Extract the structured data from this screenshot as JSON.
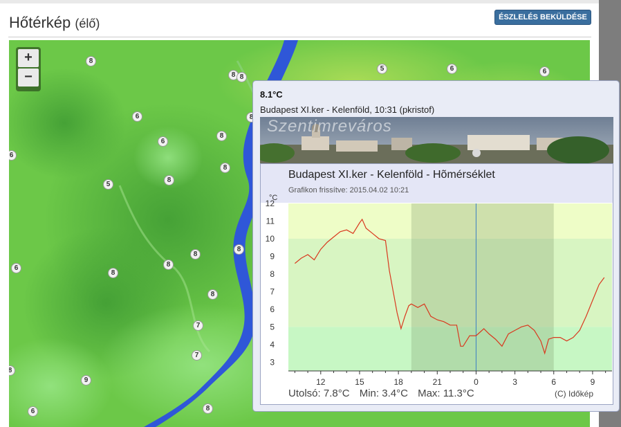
{
  "header": {
    "title": "Hőtérkép",
    "title_sub": "(élő)",
    "report_button": "ÉSZLELÉS BEKÜLDÉSE"
  },
  "map": {
    "zoom_in": "+",
    "zoom_out": "−",
    "markers": [
      "8",
      "8",
      "8",
      "5",
      "6",
      "6",
      "6",
      "6",
      "8",
      "6",
      "8",
      "5",
      "8",
      "8",
      "8",
      "8",
      "6",
      "8",
      "8",
      "8",
      "8",
      "7",
      "7",
      "9",
      "6",
      "8",
      "9"
    ]
  },
  "popup": {
    "temperature": "8.1°C",
    "location": "Budapest XI.ker - Kelenföld, 10:31 (pkristof)",
    "webcam_label": "Szentimreváros",
    "chart_title": "Budapest XI.ker - Kelenföld - Hõmérséklet",
    "chart_updated": "Grafikon frissítve: 2015.04.02 10:21",
    "stats_last": "Utolsó: 7.8°C",
    "stats_min": "Min: 3.4°C",
    "stats_max": "Max: 11.3°C",
    "copyright": "(C) Időkép"
  },
  "chart_data": {
    "type": "line",
    "ylabel": "°C",
    "ylim": [
      2.5,
      12
    ],
    "yticks": [
      3,
      4,
      5,
      6,
      7,
      8,
      9,
      10,
      11,
      12
    ],
    "xticks": [
      "12",
      "15",
      "18",
      "21",
      "0",
      "3",
      "6",
      "9"
    ],
    "series": [
      {
        "values_x_hours": [
          10,
          10.5,
          11,
          11.5,
          12,
          12.5,
          13,
          13.5,
          14,
          14.5,
          15,
          15.2,
          15.5,
          16,
          16.5,
          17,
          17.3,
          17.6,
          17.9,
          18.2,
          18.5,
          18.8,
          19,
          19.5,
          20,
          20.5,
          21,
          21.5,
          22,
          22.5,
          22.8,
          23,
          23.5,
          24,
          24.3,
          24.6,
          25,
          25.5,
          26,
          26.5,
          27,
          27.5,
          28,
          28.5,
          29,
          29.3,
          29.6,
          30,
          30.5,
          31,
          31.5,
          32,
          32.5,
          33,
          33.5,
          33.9
        ],
        "values": [
          8.6,
          8.9,
          9.1,
          8.8,
          9.4,
          9.8,
          10.1,
          10.4,
          10.5,
          10.3,
          10.9,
          11.1,
          10.6,
          10.3,
          10.0,
          9.9,
          8.2,
          7.0,
          5.8,
          4.9,
          5.6,
          6.2,
          6.3,
          6.1,
          6.3,
          5.6,
          5.4,
          5.3,
          5.1,
          5.1,
          3.9,
          3.9,
          4.5,
          4.5,
          4.7,
          4.9,
          4.6,
          4.3,
          3.9,
          4.6,
          4.8,
          5.0,
          5.1,
          4.8,
          4.2,
          3.5,
          4.3,
          4.4,
          4.4,
          4.2,
          4.4,
          4.8,
          5.6,
          6.5,
          7.4,
          7.8
        ]
      }
    ],
    "night_band_hours": [
      19,
      30
    ],
    "current_time_marker_hour": 24
  },
  "colors": {
    "line": "#d9381e",
    "marker_line": "#3a7fc4",
    "band_yellow": "#eefdc7",
    "band_yellowgreen": "#d8f5c2",
    "band_green": "#c7f7c4",
    "river": "#2f57d8"
  }
}
